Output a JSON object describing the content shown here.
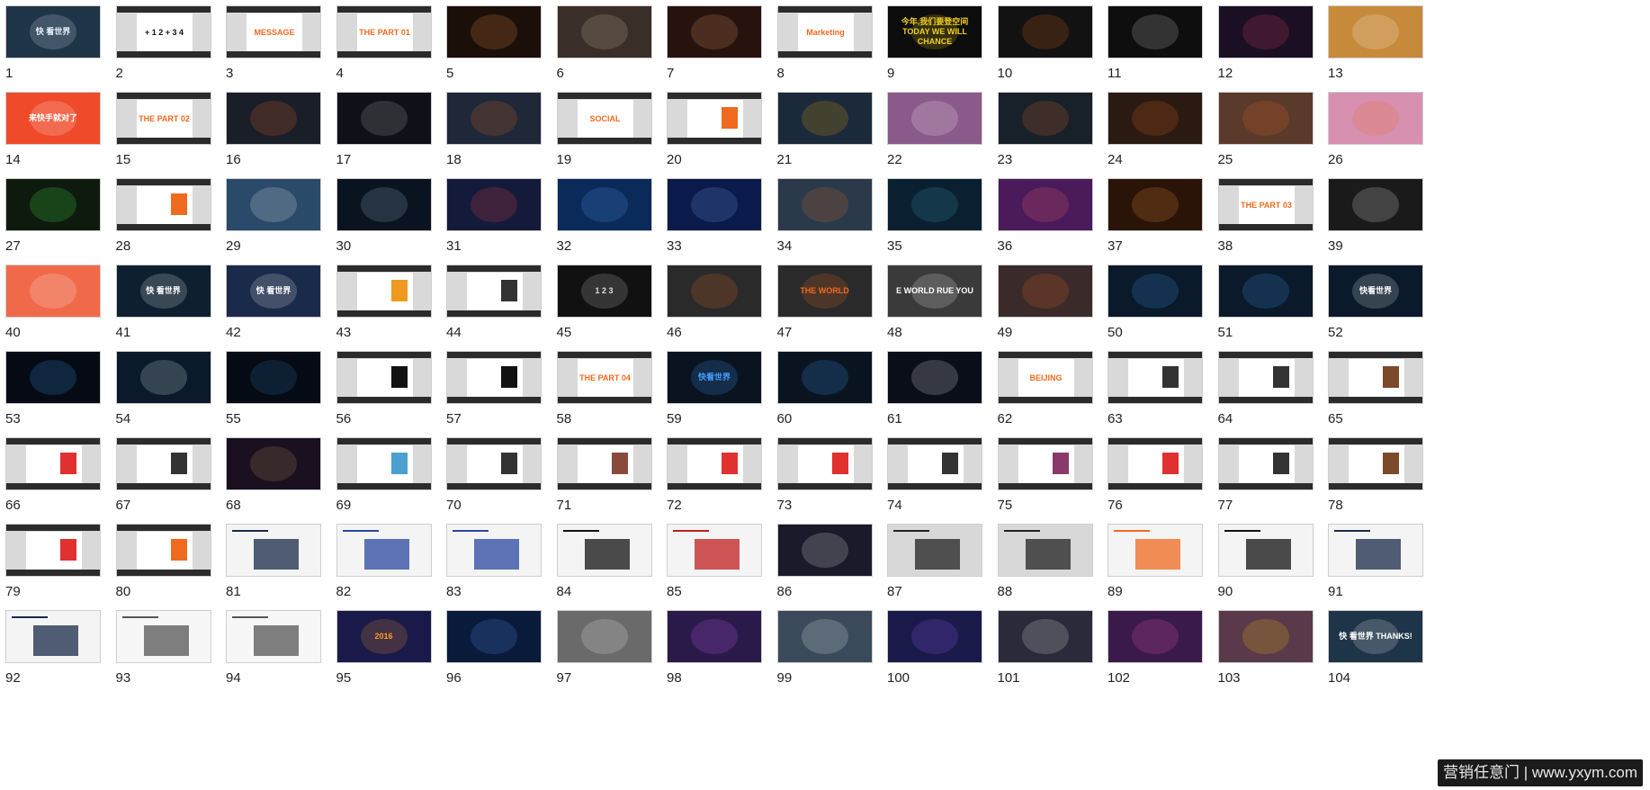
{
  "slides": [
    {
      "n": "1",
      "bg": "#1e3448",
      "fg": "#e8f0ff",
      "t": "快 看世界",
      "style": "dark"
    },
    {
      "n": "2",
      "bg": "#f5f5f5",
      "fg": "#111111",
      "t": "+ 1 2 + 3 4",
      "style": "card"
    },
    {
      "n": "3",
      "bg": "#e9e9e9",
      "fg": "#ef6a1f",
      "t": "MESSAGE",
      "style": "card"
    },
    {
      "n": "4",
      "bg": "#f0f0f0",
      "fg": "#ef6a1f",
      "t": "THE PART 01",
      "style": "part"
    },
    {
      "n": "5",
      "bg": "#1b0f0a",
      "fg": "#ff9a4a",
      "t": "",
      "style": "dark"
    },
    {
      "n": "6",
      "bg": "#3a2f28",
      "fg": "#d8c8b8",
      "t": "",
      "style": "dark"
    },
    {
      "n": "7",
      "bg": "#28120e",
      "fg": "#f0b070",
      "t": "",
      "style": "dark"
    },
    {
      "n": "8",
      "bg": "#ececec",
      "fg": "#ef6a1f",
      "t": "Marketing",
      "style": "card"
    },
    {
      "n": "9",
      "bg": "#0c0c0c",
      "fg": "#f0d020",
      "t": "今年,我们要登空间 TODAY WE WILL CHANCE",
      "style": "dark"
    },
    {
      "n": "10",
      "bg": "#121212",
      "fg": "#ef6a1f",
      "t": "",
      "style": "dark"
    },
    {
      "n": "11",
      "bg": "#0e0e0e",
      "fg": "#dddddd",
      "t": "",
      "style": "dark"
    },
    {
      "n": "12",
      "bg": "#1b0f24",
      "fg": "#e84a6a",
      "t": "",
      "style": "dark"
    },
    {
      "n": "13",
      "bg": "#c78a3a",
      "fg": "#ffffff",
      "t": "",
      "style": "dark"
    },
    {
      "n": "14",
      "bg": "#ef4a2a",
      "fg": "#ffffff",
      "t": "来快手就对了",
      "style": "dark"
    },
    {
      "n": "15",
      "bg": "#f0f0f0",
      "fg": "#ef6a1f",
      "t": "THE PART 02",
      "style": "part"
    },
    {
      "n": "16",
      "bg": "#1a1e28",
      "fg": "#ef6a1f",
      "t": "",
      "style": "dark"
    },
    {
      "n": "17",
      "bg": "#0f1018",
      "fg": "#c0c0c0",
      "t": "",
      "style": "dark"
    },
    {
      "n": "18",
      "bg": "#1e2838",
      "fg": "#ef6a1f",
      "t": "",
      "style": "dark"
    },
    {
      "n": "19",
      "bg": "#e9e9e9",
      "fg": "#ef6a1f",
      "t": "SOCIAL",
      "style": "card"
    },
    {
      "n": "20",
      "bg": "#e9e9e9",
      "fg": "#ef6a1f",
      "t": "",
      "style": "card"
    },
    {
      "n": "21",
      "bg": "#1a2a3a",
      "fg": "#ffaa00",
      "t": "",
      "style": "dark"
    },
    {
      "n": "22",
      "bg": "#8a5a8a",
      "fg": "#ffffff",
      "t": "",
      "style": "dark"
    },
    {
      "n": "23",
      "bg": "#18202a",
      "fg": "#ef6a1f",
      "t": "",
      "style": "dark"
    },
    {
      "n": "24",
      "bg": "#2a1a12",
      "fg": "#ef6a1f",
      "t": "",
      "style": "dark"
    },
    {
      "n": "25",
      "bg": "#5a3a2a",
      "fg": "#ef6a1f",
      "t": "",
      "style": "dark"
    },
    {
      "n": "26",
      "bg": "#d890b0",
      "fg": "#ef6a1f",
      "t": "",
      "style": "dark"
    },
    {
      "n": "27",
      "bg": "#0e1a0e",
      "fg": "#50ff50",
      "t": "",
      "style": "dark"
    },
    {
      "n": "28",
      "bg": "#e8e4de",
      "fg": "#ef6a1f",
      "t": "",
      "style": "card"
    },
    {
      "n": "29",
      "bg": "#2a4a6a",
      "fg": "#ffffff",
      "t": "",
      "style": "dark"
    },
    {
      "n": "30",
      "bg": "#0a1420",
      "fg": "#a0c0e0",
      "t": "",
      "style": "dark"
    },
    {
      "n": "31",
      "bg": "#141a3a",
      "fg": "#ff4a4a",
      "t": "",
      "style": "dark"
    },
    {
      "n": "32",
      "bg": "#0a2a5a",
      "fg": "#60a0ff",
      "t": "",
      "style": "dark"
    },
    {
      "n": "33",
      "bg": "#0a1a4a",
      "fg": "#80b0ff",
      "t": "",
      "style": "dark"
    },
    {
      "n": "34",
      "bg": "#2a3a4a",
      "fg": "#ef6a1f",
      "t": "",
      "style": "dark"
    },
    {
      "n": "35",
      "bg": "#0a2030",
      "fg": "#40a0c0",
      "t": "",
      "style": "dark"
    },
    {
      "n": "36",
      "bg": "#4a1a5a",
      "fg": "#ff6a6a",
      "t": "",
      "style": "dark"
    },
    {
      "n": "37",
      "bg": "#2a1408",
      "fg": "#ff9a4a",
      "t": "",
      "style": "dark"
    },
    {
      "n": "38",
      "bg": "#f0f0f0",
      "fg": "#ef6a1f",
      "t": "THE PART 03",
      "style": "part"
    },
    {
      "n": "39",
      "bg": "#1a1a1a",
      "fg": "#ffffff",
      "t": "",
      "style": "dark"
    },
    {
      "n": "40",
      "bg": "#f06a4a",
      "fg": "#ffffff",
      "t": "",
      "style": "dark"
    },
    {
      "n": "41",
      "bg": "#0e2030",
      "fg": "#ffffff",
      "t": "快 看世界",
      "style": "dark"
    },
    {
      "n": "42",
      "bg": "#1a2a4a",
      "fg": "#ffffff",
      "t": "快 看世界",
      "style": "dark"
    },
    {
      "n": "43",
      "bg": "#e8e8e8",
      "fg": "#ef9a1f",
      "t": "",
      "style": "card"
    },
    {
      "n": "44",
      "bg": "#f0f0f0",
      "fg": "#333333",
      "t": "",
      "style": "card"
    },
    {
      "n": "45",
      "bg": "#111111",
      "fg": "#dddddd",
      "t": "1 2 3",
      "style": "dark"
    },
    {
      "n": "46",
      "bg": "#2a2a2a",
      "fg": "#ef6a1f",
      "t": "",
      "style": "dark"
    },
    {
      "n": "47",
      "bg": "#2a2a2a",
      "fg": "#ef6a1f",
      "t": "THE WORLD",
      "style": "dark"
    },
    {
      "n": "48",
      "bg": "#3a3a3a",
      "fg": "#ffffff",
      "t": "E WORLD RUE YOU",
      "style": "dark"
    },
    {
      "n": "49",
      "bg": "#3a2a2a",
      "fg": "#ef6a1f",
      "t": "",
      "style": "dark"
    },
    {
      "n": "50",
      "bg": "#0a1a2a",
      "fg": "#40a0ff",
      "t": "",
      "style": "dark"
    },
    {
      "n": "51",
      "bg": "#0a1a2a",
      "fg": "#40a0ff",
      "t": "",
      "style": "dark"
    },
    {
      "n": "52",
      "bg": "#0a1a2a",
      "fg": "#ffffff",
      "t": "快看世界",
      "style": "dark"
    },
    {
      "n": "53",
      "bg": "#050a14",
      "fg": "#40a0ff",
      "t": "",
      "style": "dark"
    },
    {
      "n": "54",
      "bg": "#0a1a2a",
      "fg": "#ffffff",
      "t": "",
      "style": "dark"
    },
    {
      "n": "55",
      "bg": "#050a14",
      "fg": "#3080c0",
      "t": "",
      "style": "dark"
    },
    {
      "n": "56",
      "bg": "#f0f0f0",
      "fg": "#111111",
      "t": "",
      "style": "card"
    },
    {
      "n": "57",
      "bg": "#e8e8e8",
      "fg": "#111111",
      "t": "",
      "style": "card"
    },
    {
      "n": "58",
      "bg": "#f0f0f0",
      "fg": "#ef6a1f",
      "t": "THE PART 04",
      "style": "part"
    },
    {
      "n": "59",
      "bg": "#0a1420",
      "fg": "#40a0ff",
      "t": "快看世界",
      "style": "dark"
    },
    {
      "n": "60",
      "bg": "#0a1420",
      "fg": "#40a0ff",
      "t": "",
      "style": "dark"
    },
    {
      "n": "61",
      "bg": "#0a0e18",
      "fg": "#ffffff",
      "t": "",
      "style": "dark"
    },
    {
      "n": "62",
      "bg": "#e8e8e8",
      "fg": "#ef6a1f",
      "t": "BEIJING",
      "style": "card"
    },
    {
      "n": "63",
      "bg": "#e8e8e8",
      "fg": "#333333",
      "t": "",
      "style": "card"
    },
    {
      "n": "64",
      "bg": "#e8e8e8",
      "fg": "#333333",
      "t": "",
      "style": "card"
    },
    {
      "n": "65",
      "bg": "#e8e8e8",
      "fg": "#7a4a2a",
      "t": "",
      "style": "card"
    },
    {
      "n": "66",
      "bg": "#e8e8e8",
      "fg": "#e03030",
      "t": "",
      "style": "card"
    },
    {
      "n": "67",
      "bg": "#e8e8e8",
      "fg": "#333333",
      "t": "",
      "style": "card"
    },
    {
      "n": "68",
      "bg": "#1a1020",
      "fg": "#c0a060",
      "t": "",
      "style": "dark"
    },
    {
      "n": "69",
      "bg": "#e8e8e8",
      "fg": "#4aa0d0",
      "t": "",
      "style": "card"
    },
    {
      "n": "70",
      "bg": "#e8e8e8",
      "fg": "#333333",
      "t": "",
      "style": "card"
    },
    {
      "n": "71",
      "bg": "#e8e8e8",
      "fg": "#8a4a3a",
      "t": "",
      "style": "card"
    },
    {
      "n": "72",
      "bg": "#e8e8e8",
      "fg": "#e03030",
      "t": "",
      "style": "card"
    },
    {
      "n": "73",
      "bg": "#e8e8e8",
      "fg": "#e03030",
      "t": "",
      "style": "card"
    },
    {
      "n": "74",
      "bg": "#e8e8e8",
      "fg": "#333333",
      "t": "",
      "style": "card"
    },
    {
      "n": "75",
      "bg": "#e8e8e8",
      "fg": "#8a3a6a",
      "t": "",
      "style": "card"
    },
    {
      "n": "76",
      "bg": "#e8e8e8",
      "fg": "#e03030",
      "t": "",
      "style": "card"
    },
    {
      "n": "77",
      "bg": "#e8e8e8",
      "fg": "#333333",
      "t": "",
      "style": "card"
    },
    {
      "n": "78",
      "bg": "#e8e8e8",
      "fg": "#7a4a2a",
      "t": "",
      "style": "card"
    },
    {
      "n": "79",
      "bg": "#e8e8e8",
      "fg": "#e03030",
      "t": "",
      "style": "card"
    },
    {
      "n": "80",
      "bg": "#e8e8e8",
      "fg": "#ef6a1f",
      "t": "",
      "style": "card"
    },
    {
      "n": "81",
      "bg": "#f4f4f4",
      "fg": "#1a2a4a",
      "t": "",
      "style": "plain"
    },
    {
      "n": "82",
      "bg": "#f4f4f4",
      "fg": "#2a4aa0",
      "t": "",
      "style": "plain"
    },
    {
      "n": "83",
      "bg": "#f4f4f4",
      "fg": "#2a4aa0",
      "t": "",
      "style": "plain"
    },
    {
      "n": "84",
      "bg": "#f4f4f4",
      "fg": "#111111",
      "t": "",
      "style": "plain"
    },
    {
      "n": "85",
      "bg": "#f4f4f4",
      "fg": "#c02020",
      "t": "",
      "style": "plain"
    },
    {
      "n": "86",
      "bg": "#1a1a2a",
      "fg": "#ffffff",
      "t": "",
      "style": "dark"
    },
    {
      "n": "87",
      "bg": "#d8d8d8",
      "fg": "#222222",
      "t": "",
      "style": "plain"
    },
    {
      "n": "88",
      "bg": "#d8d8d8",
      "fg": "#222222",
      "t": "",
      "style": "plain"
    },
    {
      "n": "89",
      "bg": "#f4f4f4",
      "fg": "#ef6a1f",
      "t": "",
      "style": "plain"
    },
    {
      "n": "90",
      "bg": "#f4f4f4",
      "fg": "#111111",
      "t": "",
      "style": "plain"
    },
    {
      "n": "91",
      "bg": "#f4f4f4",
      "fg": "#1a2a4a",
      "t": "",
      "style": "plain"
    },
    {
      "n": "92",
      "bg": "#f4f4f4",
      "fg": "#1a2a4a",
      "t": "",
      "style": "plain"
    },
    {
      "n": "93",
      "bg": "#f7f7f7",
      "fg": "#555555",
      "t": "",
      "style": "plain"
    },
    {
      "n": "94",
      "bg": "#f7f7f7",
      "fg": "#555555",
      "t": "",
      "style": "plain"
    },
    {
      "n": "95",
      "bg": "#1a1a4a",
      "fg": "#ff9a2a",
      "t": "2016",
      "style": "dark"
    },
    {
      "n": "96",
      "bg": "#0a1a3a",
      "fg": "#60a0ff",
      "t": "",
      "style": "dark"
    },
    {
      "n": "97",
      "bg": "#6a6a6a",
      "fg": "#ffffff",
      "t": "",
      "style": "dark"
    },
    {
      "n": "98",
      "bg": "#2a1a4a",
      "fg": "#d060ff",
      "t": "",
      "style": "dark"
    },
    {
      "n": "99",
      "bg": "#3a4a5a",
      "fg": "#ffffff",
      "t": "",
      "style": "dark"
    },
    {
      "n": "100",
      "bg": "#1a1a4a",
      "fg": "#a060ff",
      "t": "",
      "style": "dark"
    },
    {
      "n": "101",
      "bg": "#2a2a3a",
      "fg": "#ffffff",
      "t": "",
      "style": "dark"
    },
    {
      "n": "102",
      "bg": "#3a1a4a",
      "fg": "#ff60c0",
      "t": "",
      "style": "dark"
    },
    {
      "n": "103",
      "bg": "#5a3a4a",
      "fg": "#ffcc00",
      "t": "",
      "style": "dark"
    },
    {
      "n": "104",
      "bg": "#1e3448",
      "fg": "#ffffff",
      "t": "快 看世界 THANKS!",
      "style": "dark"
    }
  ],
  "watermark": {
    "text": "营销任意门 | www.yxym.com"
  }
}
